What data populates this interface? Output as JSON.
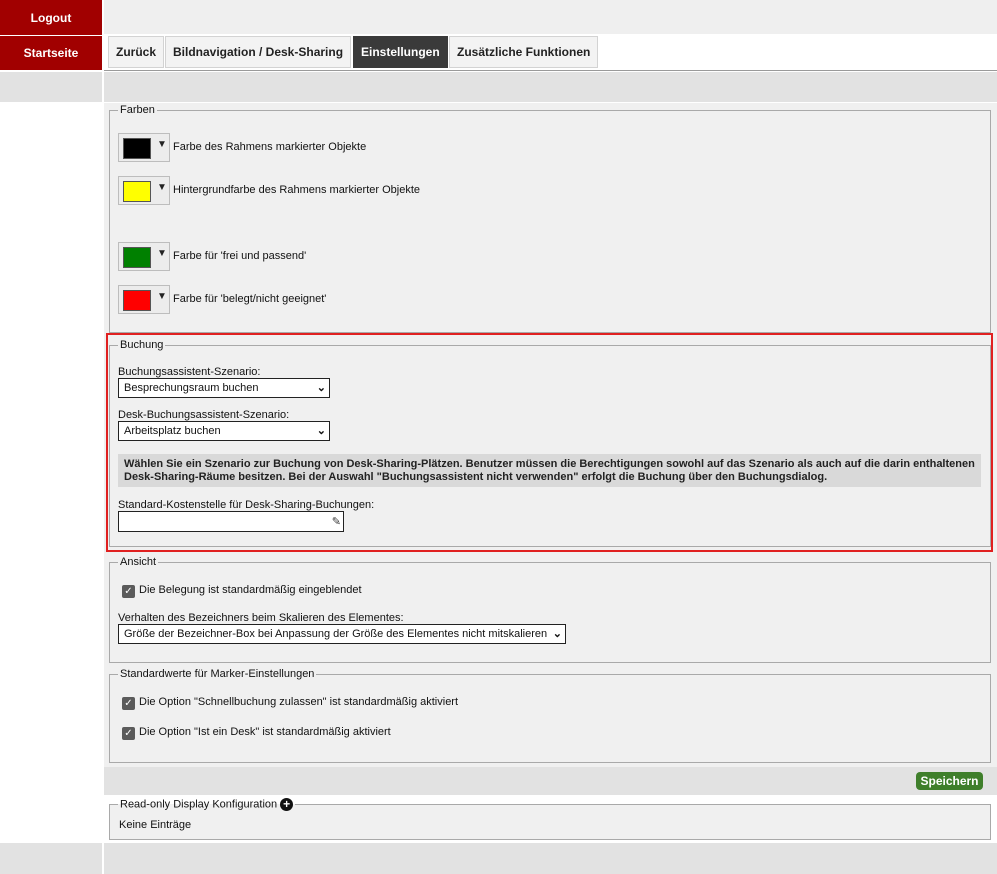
{
  "sidebar": {
    "logout_label": "Logout",
    "home_label": "Startseite"
  },
  "tabs": [
    {
      "label": "Zurück",
      "active": false
    },
    {
      "label": "Bildnavigation / Desk-Sharing",
      "active": false
    },
    {
      "label": "Einstellungen",
      "active": true
    },
    {
      "label": "Zusätzliche Funktionen",
      "active": false
    }
  ],
  "colors_section": {
    "legend": "Farben",
    "items": [
      {
        "label": "Farbe des Rahmens markierter Objekte",
        "color": "#000000"
      },
      {
        "label": "Hintergrundfarbe des Rahmens markierter Objekte",
        "color": "#ffff00"
      },
      {
        "label": "Farbe für 'frei und passend'",
        "color": "#008000"
      },
      {
        "label": "Farbe für 'belegt/nicht geeignet'",
        "color": "#ff0000"
      }
    ],
    "dropdown_icon": "triangle-down-icon"
  },
  "booking_section": {
    "legend": "Buchung",
    "scenario_label": "Buchungsassistent-Szenario:",
    "scenario_value": "Besprechungsraum buchen",
    "desk_scenario_label": "Desk-Buchungsassistent-Szenario:",
    "desk_scenario_value": "Arbeitsplatz buchen",
    "info_line1": "Wählen Sie ein Szenario zur Buchung von Desk-Sharing-Plätzen. Benutzer müssen die Berechtigungen sowohl auf das Szenario als auch auf die darin enthaltenen",
    "info_line2": "Desk-Sharing-Räume besitzen. Bei der Auswahl \"Buchungsassistent nicht verwenden\" erfolgt die Buchung über den Buchungsdialog.",
    "cost_center_label": "Standard-Kostenstelle für Desk-Sharing-Buchungen:",
    "cost_center_value": "",
    "highlight_color": "#e02020"
  },
  "view_section": {
    "legend": "Ansicht",
    "checkbox_label": "Die Belegung ist standardmäßig eingeblendet",
    "checkbox_checked": true,
    "scaling_label": "Verhalten des Bezeichners beim Skalieren des Elementes:",
    "scaling_value": "Größe der Bezeichner-Box bei Anpassung der Größe des Elementes nicht mitskalieren"
  },
  "marker_section": {
    "legend": "Standardwerte für Marker-Einstellungen",
    "options": [
      {
        "label": "Die Option \"Schnellbuchung zulassen\" ist standardmäßig aktiviert",
        "checked": true
      },
      {
        "label": "Die Option \"Ist ein Desk\" ist standardmäßig aktiviert",
        "checked": true
      }
    ]
  },
  "save_label": "Speichern",
  "readonly_section": {
    "legend": "Read-only Display Konfiguration",
    "empty_text": "Keine Einträge"
  },
  "brand_colors": {
    "sidebar_red": "#a10000",
    "active_tab": "#3a3a3a",
    "save_green": "#3f7f2b"
  }
}
